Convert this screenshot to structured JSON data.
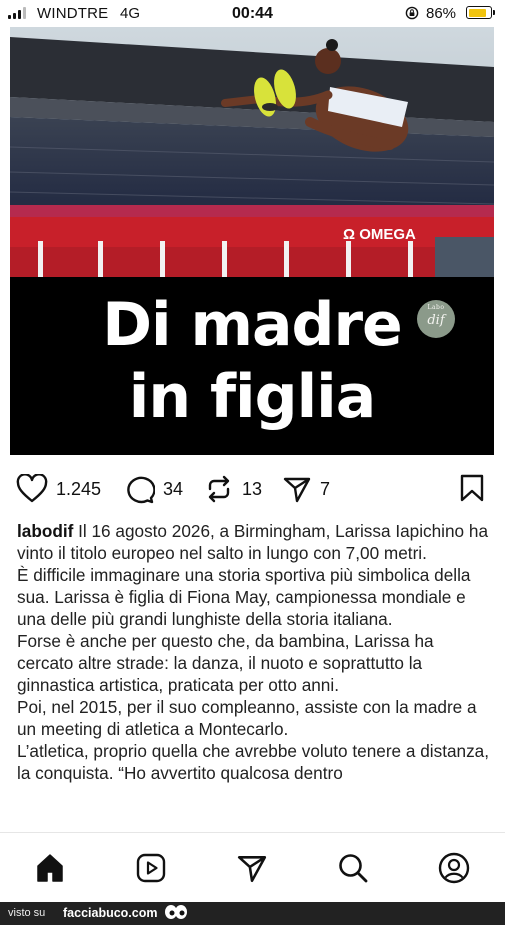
{
  "status_bar": {
    "carrier": "WINDTRE",
    "network": "4G",
    "time": "00:44",
    "battery_percent": "86%",
    "battery_level": 0.86,
    "battery_color": "#f1c40f"
  },
  "post": {
    "headline_line1": "Di madre",
    "headline_line2": "in figlia",
    "badge_top": "Labo",
    "badge_main": "dif",
    "actions": {
      "likes": "1.245",
      "comments": "34",
      "reposts": "13",
      "shares": "7"
    },
    "caption": {
      "username": "labodif",
      "paragraph1": "Il 16 agosto 2026, a Birmingham, Larissa Iapichino ha vinto il titolo europeo nel salto in lungo con 7,00 metri.",
      "paragraph2": "È difficile immaginare una storia sportiva più simbolica della sua. Larissa è figlia di Fiona May, campionessa mondiale e una delle più grandi lunghiste della storia italiana.",
      "paragraph3": "Forse è anche per questo che, da bambina, Larissa ha cercato altre strade: la danza, il nuoto e soprattutto la ginnastica artistica, praticata per otto anni.",
      "paragraph4": "Poi, nel 2015, per il suo compleanno, assiste con la madre a un meeting di atletica a Montecarlo.",
      "paragraph5": "L’atletica, proprio quella che avrebbe voluto tenere a distanza, la conquista. “Ho avvertito qualcosa dentro"
    },
    "photo_board_text": "Ω OMEGA"
  },
  "nav": {
    "icons": [
      "home-icon",
      "reels-icon",
      "send-icon",
      "search-icon",
      "profile-icon"
    ]
  },
  "watermark": {
    "prefix": "visto su",
    "site": "facciabuco.com"
  }
}
